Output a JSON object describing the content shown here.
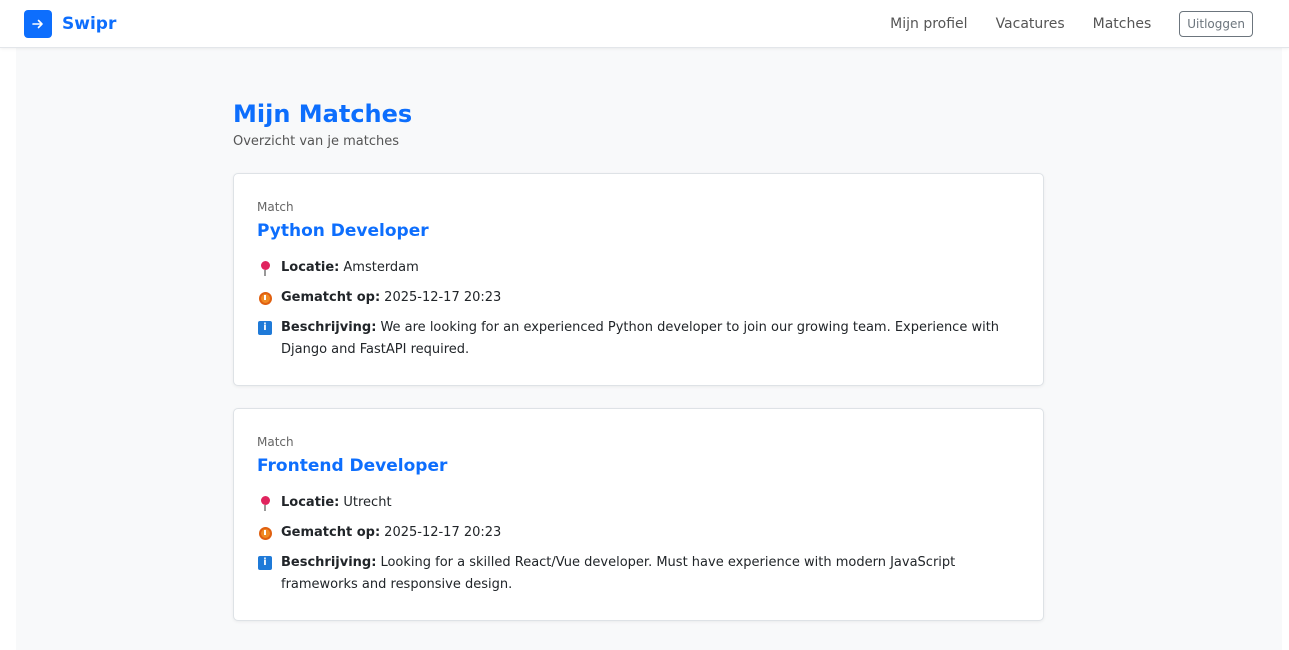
{
  "nav": {
    "brand": "Swipr",
    "brand_icon": "arrow-right-icon",
    "links": [
      "Mijn profiel",
      "Vacatures",
      "Matches"
    ],
    "logout": "Uitloggen"
  },
  "page": {
    "title": "Mijn Matches",
    "subtitle": "Overzicht van je matches"
  },
  "labels": {
    "locatie": "Locatie:",
    "gematcht": "Gematcht op:",
    "beschrijving": "Beschrijving:"
  },
  "matches": [
    {
      "label": "Match",
      "title": "Python Developer",
      "locatie": "Amsterdam",
      "gematcht_op": "2025-12-17 20:23",
      "beschrijving": "We are looking for an experienced Python developer to join our growing team. Experience with Django and FastAPI required."
    },
    {
      "label": "Match",
      "title": "Frontend Developer",
      "locatie": "Utrecht",
      "gematcht_op": "2025-12-17 20:23",
      "beschrijving": "Looking for a skilled React/Vue developer. Must have experience with modern JavaScript frameworks and responsive design."
    }
  ],
  "colors": {
    "primary": "#0d6efd",
    "background": "#f8f9fa"
  }
}
